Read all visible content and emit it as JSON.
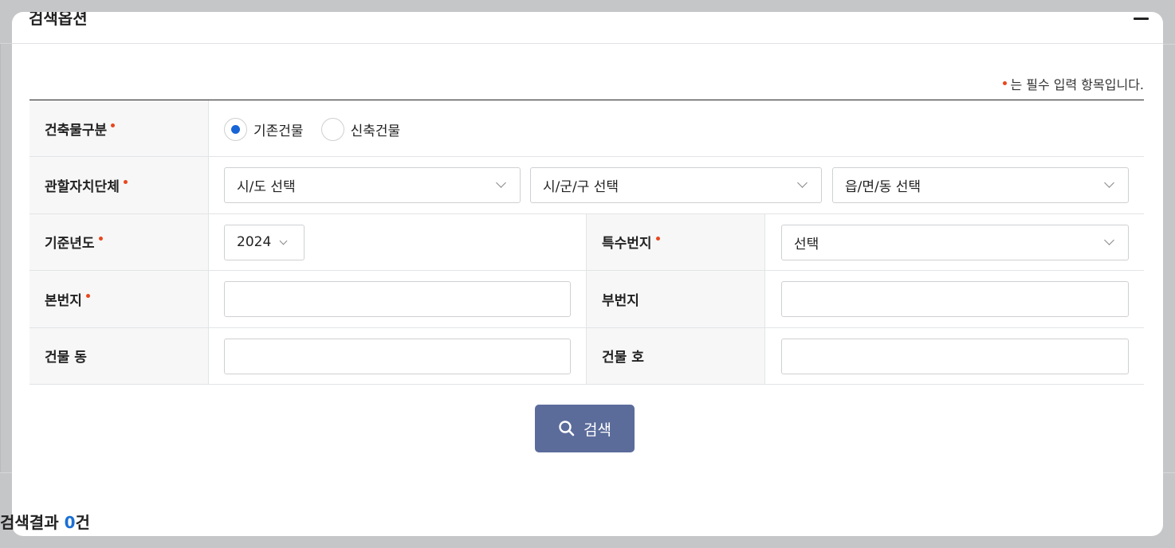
{
  "header": {
    "title": "검색옵션"
  },
  "required_note": "는 필수 입력 항목입니다.",
  "form": {
    "building_type": {
      "label": "건축물구분",
      "options": [
        {
          "label": "기존건물",
          "checked": true
        },
        {
          "label": "신축건물",
          "checked": false
        }
      ]
    },
    "jurisdiction": {
      "label": "관할자치단체",
      "sido_value": "시/도 선택",
      "sigungu_value": "시/군/구 선택",
      "eupmyeondong_value": "읍/면/동 선택"
    },
    "base_year": {
      "label": "기준년도",
      "value": "2024"
    },
    "special_lot": {
      "label": "특수번지",
      "value": "선택"
    },
    "main_lot": {
      "label": "본번지",
      "value": ""
    },
    "sub_lot": {
      "label": "부번지",
      "value": ""
    },
    "building_dong": {
      "label": "건물 동",
      "value": ""
    },
    "building_ho": {
      "label": "건물 호",
      "value": ""
    }
  },
  "search_button": {
    "label": "검색"
  },
  "result": {
    "prefix": "검색결과 ",
    "count": "0",
    "suffix": "건"
  },
  "colors": {
    "accent": "#5b6c9b",
    "required": "#e8471f",
    "radio_checked": "#1864d6",
    "count": "#1a6fd4"
  }
}
